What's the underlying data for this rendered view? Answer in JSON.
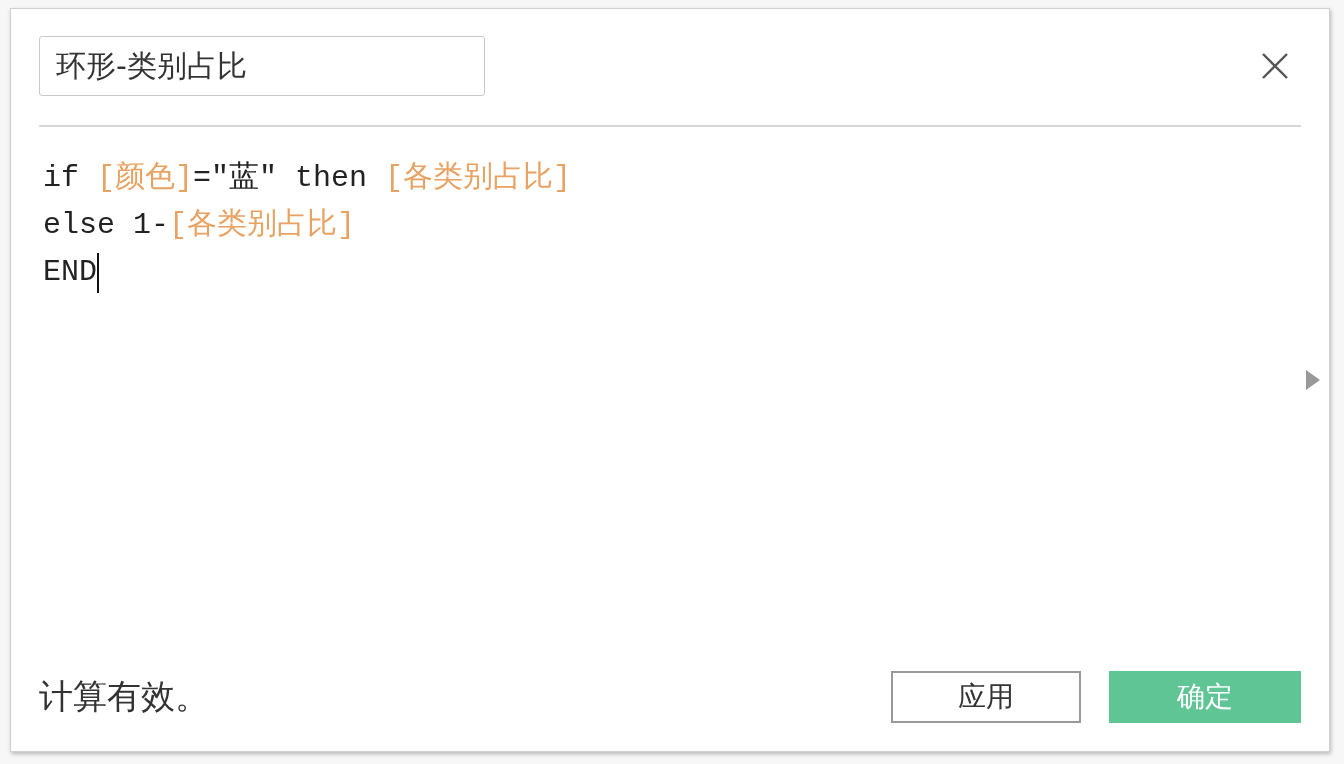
{
  "name_field": {
    "value": "环形-类别占比"
  },
  "formula": [
    [
      {
        "text": "if ",
        "kind": "code"
      },
      {
        "text": "[颜色]",
        "kind": "field"
      },
      {
        "text": "=\"蓝\" then ",
        "kind": "code"
      },
      {
        "text": "[各类别占比]",
        "kind": "field"
      }
    ],
    [
      {
        "text": "else 1-",
        "kind": "code"
      },
      {
        "text": "[各类别占比]",
        "kind": "field"
      }
    ],
    [
      {
        "text": "END",
        "kind": "code"
      }
    ]
  ],
  "status": "计算有效。",
  "buttons": [
    {
      "label": "应用",
      "kind": "secondary"
    },
    {
      "label": "确定",
      "kind": "primary"
    }
  ]
}
